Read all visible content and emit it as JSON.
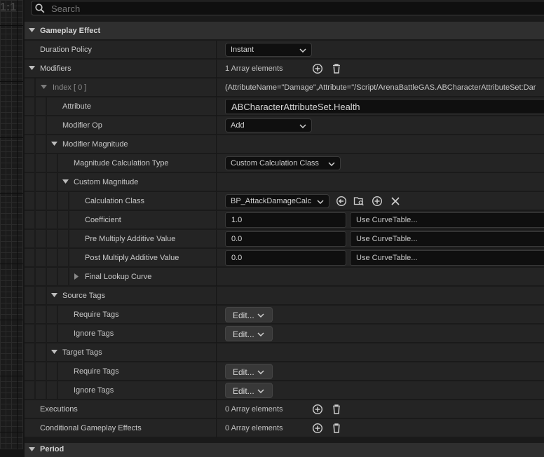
{
  "viewport": {
    "zoom_label": "1:1"
  },
  "search": {
    "placeholder": "Search"
  },
  "category": {
    "title": "Gameplay Effect",
    "bottom_title": "Period"
  },
  "rows": {
    "duration_policy": {
      "label": "Duration Policy",
      "value": "Instant"
    },
    "modifiers": {
      "label": "Modifiers",
      "count": "1 Array elements"
    },
    "index0": {
      "label": "Index [ 0 ]",
      "value": "(AttributeName=\"Damage\",Attribute=\"/Script/ArenaBattleGAS.ABCharacterAttributeSet:Dar"
    },
    "attribute": {
      "label": "Attribute",
      "value": "ABCharacterAttributeSet.Health"
    },
    "modifier_op": {
      "label": "Modifier Op",
      "value": "Add"
    },
    "modifier_magnitude": {
      "label": "Modifier Magnitude"
    },
    "magnitude_calc_type": {
      "label": "Magnitude Calculation Type",
      "value": "Custom Calculation Class"
    },
    "custom_magnitude": {
      "label": "Custom Magnitude"
    },
    "calculation_class": {
      "label": "Calculation Class",
      "value": "BP_AttackDamageCalc"
    },
    "coefficient": {
      "label": "Coefficient",
      "value": "1.0",
      "curve": "Use CurveTable..."
    },
    "pre_multiply": {
      "label": "Pre Multiply Additive Value",
      "value": "0.0",
      "curve": "Use CurveTable..."
    },
    "post_multiply": {
      "label": "Post Multiply Additive Value",
      "value": "0.0",
      "curve": "Use CurveTable..."
    },
    "final_lookup_curve": {
      "label": "Final Lookup Curve"
    },
    "source_tags": {
      "label": "Source Tags"
    },
    "source_require": {
      "label": "Require Tags",
      "button": "Edit..."
    },
    "source_ignore": {
      "label": "Ignore Tags",
      "button": "Edit..."
    },
    "target_tags": {
      "label": "Target Tags"
    },
    "target_require": {
      "label": "Require Tags",
      "button": "Edit..."
    },
    "target_ignore": {
      "label": "Ignore Tags",
      "button": "Edit..."
    },
    "executions": {
      "label": "Executions",
      "count": "0 Array elements"
    },
    "conditional_effects": {
      "label": "Conditional Gameplay Effects",
      "count": "0 Array elements"
    }
  },
  "icons": {
    "add": "add-element-icon",
    "delete": "delete-all-icon",
    "use_selected": "use-selected-icon",
    "browse": "browse-asset-icon",
    "clear": "clear-icon"
  },
  "colors": {
    "panel_bg": "#1a1a1a",
    "row_bg": "#242424",
    "category_bg": "#2f2f2f",
    "field_bg": "#0f0f0f"
  }
}
